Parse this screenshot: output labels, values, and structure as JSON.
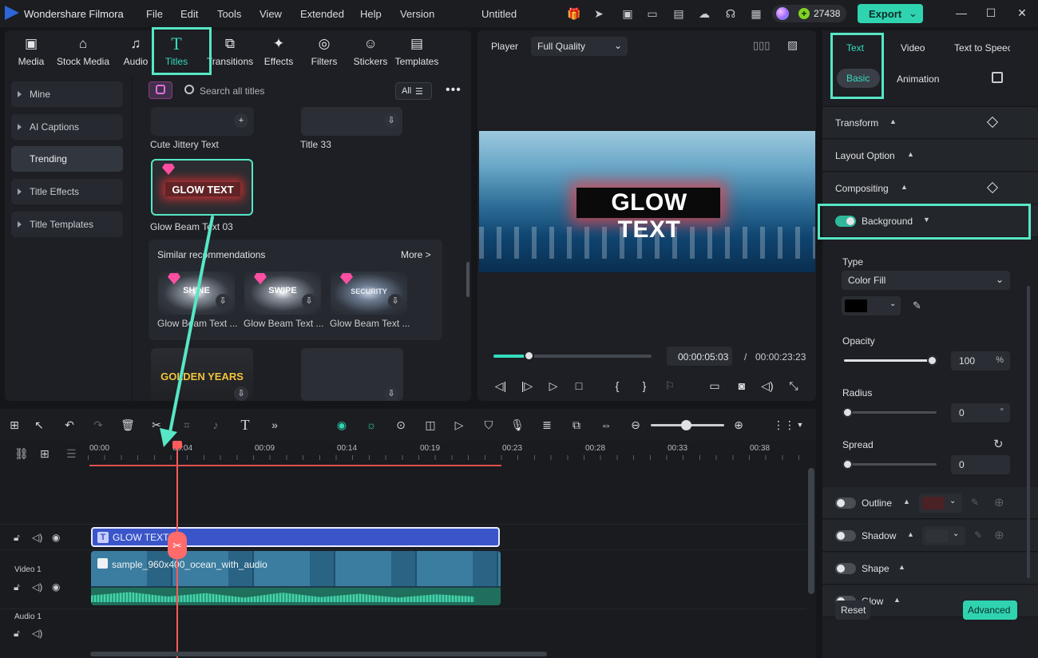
{
  "app": {
    "name": "Wondershare Filmora",
    "document_title": "Untitled",
    "credits": "27438",
    "export_label": "Export"
  },
  "menu": [
    "File",
    "Edit",
    "Tools",
    "View",
    "Extended",
    "Help",
    "Version"
  ],
  "library": {
    "tabs": [
      {
        "label": "Media",
        "icon": "media-icon"
      },
      {
        "label": "Stock Media",
        "icon": "stock-media-icon"
      },
      {
        "label": "Audio",
        "icon": "audio-icon"
      },
      {
        "label": "Titles",
        "icon": "titles-icon"
      },
      {
        "label": "Transitions",
        "icon": "transitions-icon"
      },
      {
        "label": "Effects",
        "icon": "effects-icon"
      },
      {
        "label": "Filters",
        "icon": "filters-icon"
      },
      {
        "label": "Stickers",
        "icon": "stickers-icon"
      },
      {
        "label": "Templates",
        "icon": "templates-icon"
      }
    ],
    "sidebar": [
      "Mine",
      "AI Captions",
      "Trending",
      "Title Effects",
      "Title Templates"
    ],
    "search_placeholder": "Search all titles",
    "filter_label": "All",
    "items": [
      {
        "caption": "Cute Jittery Text"
      },
      {
        "caption": "Title 33"
      },
      {
        "caption": "Glow Beam Text 03",
        "thumb_text": "GLOW TEXT"
      }
    ],
    "bottom_thumb_text": "GOLDEN YEARS",
    "similar": {
      "header": "Similar recommendations",
      "more": "More >",
      "items": [
        {
          "caption": "Glow Beam Text ...",
          "thumb_text": "SHINE"
        },
        {
          "caption": "Glow Beam Text ...",
          "thumb_text": "SWIPE"
        },
        {
          "caption": "Glow Beam Text ...",
          "thumb_text": "SECURITY"
        }
      ]
    }
  },
  "player": {
    "label": "Player",
    "quality": "Full Quality",
    "overlay_text": "GLOW TEXT",
    "progress": 0.22,
    "time_current": "00:00:05:03",
    "time_separator": "/",
    "time_total": "00:00:23:23"
  },
  "properties": {
    "tabs": [
      "Text",
      "Video",
      "Text to Speech"
    ],
    "subtabs": [
      "Basic",
      "Animation"
    ],
    "sections": {
      "transform": "Transform",
      "layout": "Layout Option",
      "compositing": "Compositing",
      "background": "Background"
    },
    "background": {
      "type_label": "Type",
      "type_value": "Color Fill",
      "color": "#000000",
      "opacity_label": "Opacity",
      "opacity_value": "100",
      "opacity_unit": "%",
      "opacity": 1.0,
      "radius_label": "Radius",
      "radius_value": "0",
      "radius_unit": "°",
      "spread_label": "Spread",
      "spread_value": "0"
    },
    "toggles": [
      "Outline",
      "Shadow",
      "Shape",
      "Glow"
    ],
    "outline_color": "#4a2125",
    "shadow_color": "#2f3237",
    "reset_label": "Reset",
    "advanced_label": "Advanced"
  },
  "timeline": {
    "ticks": [
      "00:00",
      "00:04",
      "00:09",
      "00:14",
      "00:19",
      "00:23",
      "00:28",
      "00:33",
      "00:38"
    ],
    "text_clip": "GLOW TEXT",
    "video_clip": "sample_960x400_ocean_with_audio",
    "tracks": [
      "Video 1",
      "Audio 1"
    ]
  },
  "colors": {
    "accent": "#35dcbf",
    "export": "#2fd3b0",
    "text_clip": "#3a55c9",
    "playhead": "#ff5b5b"
  }
}
